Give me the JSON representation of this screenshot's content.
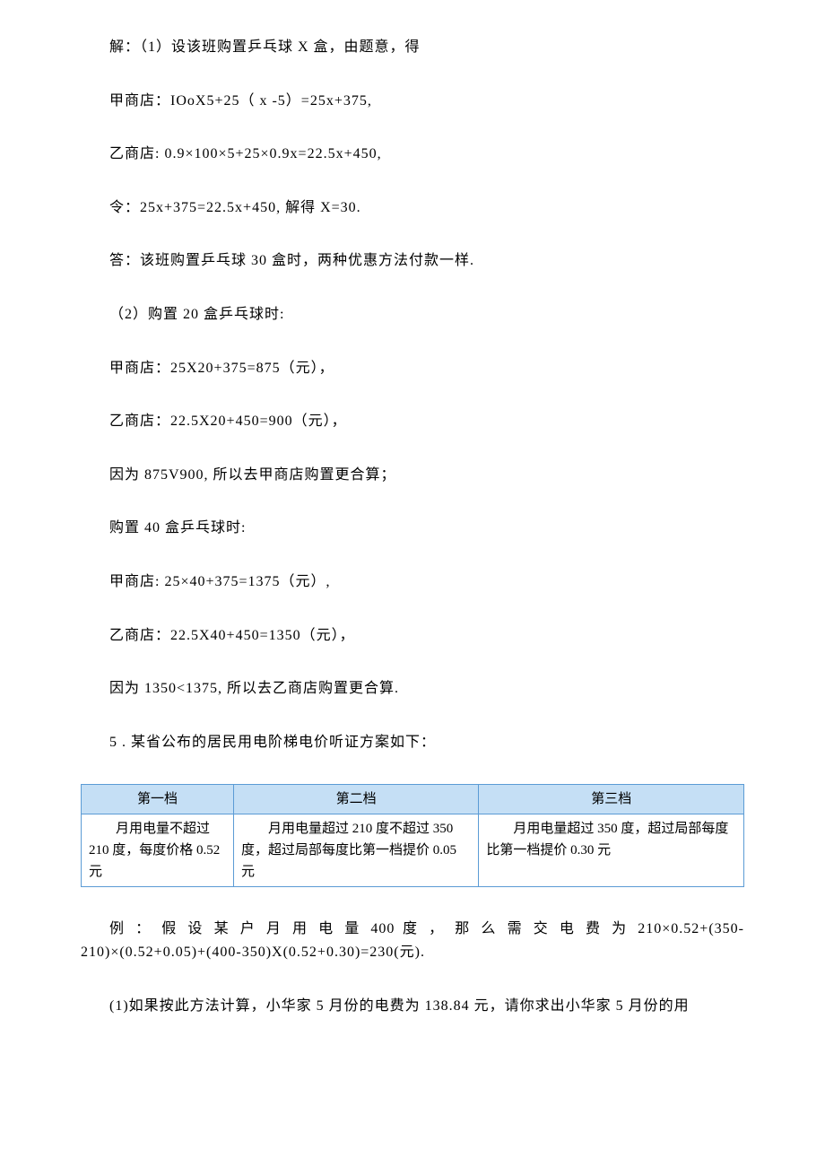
{
  "paragraphs": {
    "p1": "解：（1）设该班购置乒乓球 X 盒，由题意，得",
    "p2": "甲商店：IOoX5+25（ x -5）=25x+375,",
    "p3": "乙商店: 0.9×100×5+25×0.9x=22.5x+450,",
    "p4": "令：25x+375=22.5x+450, 解得 X=30.",
    "p5": "答：该班购置乒乓球 30 盒时，两种优惠方法付款一样.",
    "p6": "（2）购置 20 盒乒乓球时:",
    "p7": "甲商店：25X20+375=875（元），",
    "p8": "乙商店：22.5X20+450=900（元），",
    "p9": "因为 875V900, 所以去甲商店购置更合算；",
    "p10": "购置 40 盒乒乓球时:",
    "p11": "甲商店: 25×40+375=1375（元）,",
    "p12": "乙商店：22.5X40+450=1350（元），",
    "p13": "因为 1350<1375, 所以去乙商店购置更合算.",
    "p14": "5 . 某省公布的居民用电阶梯电价听证方案如下：",
    "p15": "例 ： 假 设 某 户 月 用 电 量 400 度 ， 那 么 需 交 电 费 为 210×0.52+(350-210)×(0.52+0.05)+(400-350)X(0.52+0.30)=230(元).",
    "p16": "(1)如果按此方法计算，小华家 5 月份的电费为 138.84 元，请你求出小华家 5 月份的用"
  },
  "table": {
    "headers": {
      "h1": "第一档",
      "h2": "第二档",
      "h3": "第三档"
    },
    "cells": {
      "c1": "月用电量不超过 210 度，每度价格 0.52 元",
      "c2": "月用电量超过 210 度不超过 350 度，超过局部每度比第一档提价 0.05 元",
      "c3": "月用电量超过 350 度，超过局部每度比第一档提价 0.30 元"
    }
  }
}
